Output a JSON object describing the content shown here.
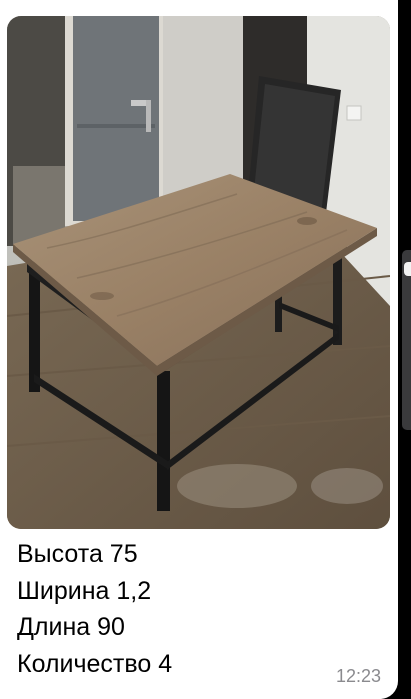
{
  "message": {
    "photo_alt": "Стол с деревянной столешницей и чёрным металлическим каркасом",
    "lines": [
      "Высота 75",
      "Ширина 1,2",
      "Длина 90",
      "Количество 4"
    ],
    "time": "12:23"
  },
  "colors": {
    "background": "#000000",
    "bubble": "#ffffff",
    "text": "#000000",
    "timestamp": "#8a8a8e"
  }
}
